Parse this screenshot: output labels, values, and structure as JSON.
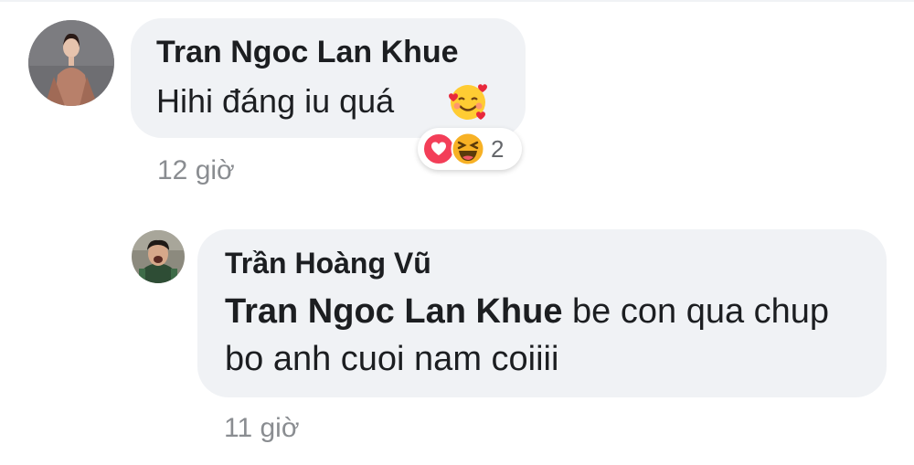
{
  "comment": {
    "author": "Tran Ngoc Lan Khue",
    "text": "Hihi đáng iu quá",
    "emoji": "smiling-face-with-hearts",
    "reactions": {
      "types": [
        "love",
        "haha"
      ],
      "count": "2"
    },
    "timestamp": "12 giờ"
  },
  "reply": {
    "author": "Trần Hoàng Vũ",
    "mention": "Tran Ngoc Lan Khue",
    "text": " be con qua chup bo anh cuoi nam coiiii",
    "timestamp": "11 giờ"
  },
  "colors": {
    "bubble": "#f0f2f5",
    "text": "#1c1e21",
    "timestamp": "#8a8d91",
    "love": "#f33e58",
    "haha": "#f7b125"
  }
}
